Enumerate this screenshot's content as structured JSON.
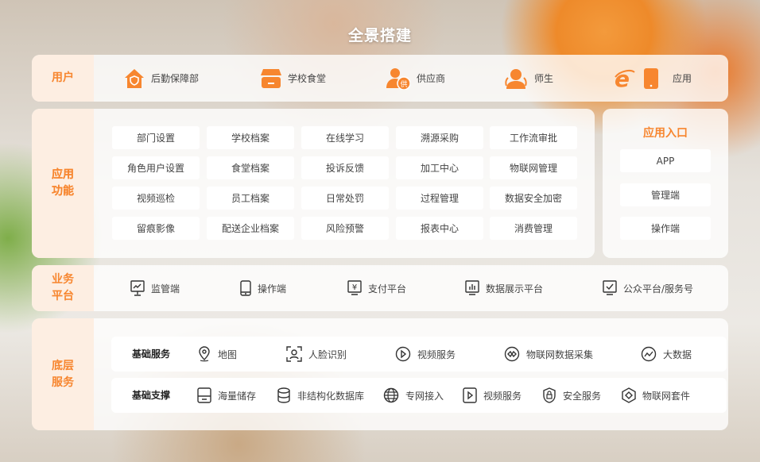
{
  "title": "全景搭建",
  "users": {
    "label": "用户",
    "items": [
      {
        "label": "后勤保障部",
        "icon": "house-shield-icon"
      },
      {
        "label": "学校食堂",
        "icon": "canteen-icon"
      },
      {
        "label": "供应商",
        "icon": "supplier-icon"
      },
      {
        "label": "师生",
        "icon": "person-icon"
      },
      {
        "label": "应用",
        "icon": "ie-phone-icon"
      }
    ]
  },
  "functions": {
    "label": "应用功能",
    "label_lines": [
      "应用",
      "功能"
    ],
    "buttons": [
      "部门设置",
      "学校档案",
      "在线学习",
      "溯源采购",
      "工作流审批",
      "角色用户设置",
      "食堂档案",
      "投诉反馈",
      "加工中心",
      "物联网管理",
      "视频巡检",
      "员工档案",
      "日常处罚",
      "过程管理",
      "数据安全加密",
      "留痕影像",
      "配送企业档案",
      "风险预警",
      "报表中心",
      "消费管理"
    ]
  },
  "entry": {
    "title": "应用入口",
    "buttons": [
      "APP",
      "管理端",
      "操作端"
    ]
  },
  "business": {
    "label_lines": [
      "业务",
      "平台"
    ],
    "items": [
      {
        "label": "监管端",
        "icon": "monitor-chart-icon"
      },
      {
        "label": "操作端",
        "icon": "phone-icon"
      },
      {
        "label": "支付平台",
        "icon": "yen-monitor-icon"
      },
      {
        "label": "数据展示平台",
        "icon": "bar-chart-monitor-icon"
      },
      {
        "label": "公众平台/服务号",
        "icon": "check-monitor-icon"
      }
    ]
  },
  "base": {
    "label_lines": [
      "底层",
      "服务"
    ],
    "services": {
      "title": "基础服务",
      "items": [
        {
          "label": "地图",
          "icon": "map-pin-icon"
        },
        {
          "label": "人脸识别",
          "icon": "face-scan-icon"
        },
        {
          "label": "视频服务",
          "icon": "play-circle-icon"
        },
        {
          "label": "物联网数据采集",
          "icon": "iot-circle-icon"
        },
        {
          "label": "大数据",
          "icon": "trend-circle-icon"
        }
      ]
    },
    "support": {
      "title": "基础支撑",
      "items": [
        {
          "label": "海量储存",
          "icon": "storage-icon"
        },
        {
          "label": "非结构化数据库",
          "icon": "database-icon"
        },
        {
          "label": "专网接入",
          "icon": "globe-icon"
        },
        {
          "label": "视频服务",
          "icon": "play-square-icon"
        },
        {
          "label": "安全服务",
          "icon": "lock-shield-icon"
        },
        {
          "label": "物联网套件",
          "icon": "hexagon-icon"
        }
      ]
    }
  },
  "colors": {
    "accent": "#f7862f",
    "label_bg": "#fdeee2"
  }
}
